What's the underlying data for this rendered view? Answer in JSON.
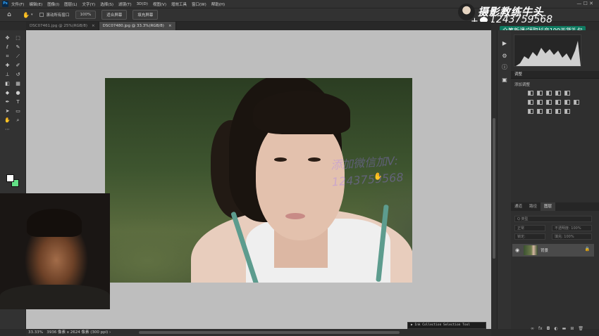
{
  "menubar": {
    "app_icon": "Ps",
    "items": [
      "文件(F)",
      "编辑(E)",
      "图像(I)",
      "图层(L)",
      "文字(Y)",
      "选择(S)",
      "滤镜(T)",
      "3D(D)",
      "视图(V)",
      "增效工具",
      "窗口(W)",
      "帮助(H)"
    ]
  },
  "options": {
    "scroll_all_label": "滚动所有窗口",
    "zoom_value": "100%",
    "fit_screen_label": "适合屏幕",
    "fill_screen_label": "填充屏幕"
  },
  "brand": {
    "title": "摄影教练牛头",
    "wechat_id": "1243759568",
    "promo": "众筹新课/领取抖音199干货礼包"
  },
  "tabs": [
    {
      "label": "DSC07461.jpg @ 25%(RGB/8)",
      "close": "×"
    },
    {
      "label": "DSC07480.jpg @ 33.3%(RGB/8)",
      "close": "×"
    }
  ],
  "watermark": {
    "line1": "添加微信加V:",
    "line2": "1243759568"
  },
  "status": {
    "zoom": "33.33%",
    "doc_info": "3936 像素 x 2624 像素 (300 ppi)"
  },
  "popup": {
    "text": "▶ Ink Collection Selection Tool"
  },
  "panels": {
    "adjustments_title": "调整",
    "add_adjustment_label": "添加调整",
    "layer_tabs": [
      "通道",
      "路径",
      "图层"
    ],
    "layer_type_placeholder": "Q 类型",
    "blend_mode": "正常",
    "opacity_label": "不透明度: 100%",
    "lock_label": "锁定:",
    "fill_label": "填充: 100%",
    "layer_name": "背景"
  },
  "colors": {
    "foreground": "#ffffff",
    "background": "#62e086",
    "promo_bg": "#0e7a60",
    "canvas_bg": "#bebebe"
  },
  "icons": {
    "tools": [
      "move-icon",
      "marquee-icon",
      "lasso-icon",
      "quick-select-icon",
      "crop-icon",
      "eyedropper-icon",
      "healing-icon",
      "brush-icon",
      "clone-stamp-icon",
      "history-brush-icon",
      "eraser-icon",
      "gradient-icon",
      "blur-icon",
      "dodge-icon",
      "pen-icon",
      "type-icon",
      "path-select-icon",
      "shape-icon",
      "hand-icon",
      "zoom-icon"
    ]
  }
}
